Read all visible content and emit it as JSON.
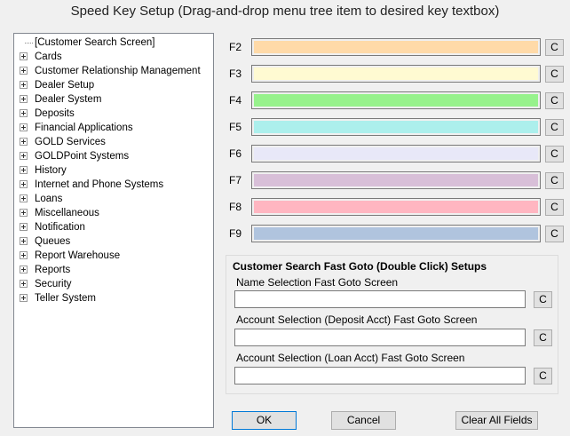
{
  "window": {
    "title": "Speed Key Setup   (Drag-and-drop menu tree item to desired key textbox)"
  },
  "tree": {
    "items": [
      {
        "label": "[Customer Search Screen]",
        "expandable": false
      },
      {
        "label": "Cards",
        "expandable": true
      },
      {
        "label": "Customer Relationship Management",
        "expandable": true
      },
      {
        "label": "Dealer Setup",
        "expandable": true
      },
      {
        "label": "Dealer System",
        "expandable": true
      },
      {
        "label": "Deposits",
        "expandable": true
      },
      {
        "label": "Financial Applications",
        "expandable": true
      },
      {
        "label": "GOLD Services",
        "expandable": true
      },
      {
        "label": "GOLDPoint Systems",
        "expandable": true
      },
      {
        "label": "History",
        "expandable": true
      },
      {
        "label": "Internet and Phone Systems",
        "expandable": true
      },
      {
        "label": "Loans",
        "expandable": true
      },
      {
        "label": "Miscellaneous",
        "expandable": true
      },
      {
        "label": "Notification",
        "expandable": true
      },
      {
        "label": "Queues",
        "expandable": true
      },
      {
        "label": "Report Warehouse",
        "expandable": true
      },
      {
        "label": "Reports",
        "expandable": true
      },
      {
        "label": "Security",
        "expandable": true
      },
      {
        "label": "Teller System",
        "expandable": true
      }
    ]
  },
  "speed_keys": [
    {
      "key": "F2",
      "color": "#ffdaa8",
      "clear": "C"
    },
    {
      "key": "F3",
      "color": "#fffad2",
      "clear": "C"
    },
    {
      "key": "F4",
      "color": "#97f28c",
      "clear": "C"
    },
    {
      "key": "F5",
      "color": "#acefec",
      "clear": "C"
    },
    {
      "key": "F6",
      "color": "#e8e8f8",
      "clear": "C"
    },
    {
      "key": "F7",
      "color": "#d8bfd8",
      "clear": "C"
    },
    {
      "key": "F8",
      "color": "#ffb6c1",
      "clear": "C"
    },
    {
      "key": "F9",
      "color": "#b0c4de",
      "clear": "C"
    }
  ],
  "fast_goto": {
    "title": "Customer Search Fast Goto (Double Click) Setups",
    "fields": [
      {
        "label": "Name Selection Fast Goto Screen",
        "value": "",
        "clear": "C"
      },
      {
        "label": "Account Selection (Deposit Acct) Fast Goto Screen",
        "value": "",
        "clear": "C"
      },
      {
        "label": "Account Selection (Loan Acct) Fast Goto Screen",
        "value": "",
        "clear": "C"
      }
    ]
  },
  "buttons": {
    "ok": "OK",
    "cancel": "Cancel",
    "clear_all": "Clear All Fields"
  }
}
